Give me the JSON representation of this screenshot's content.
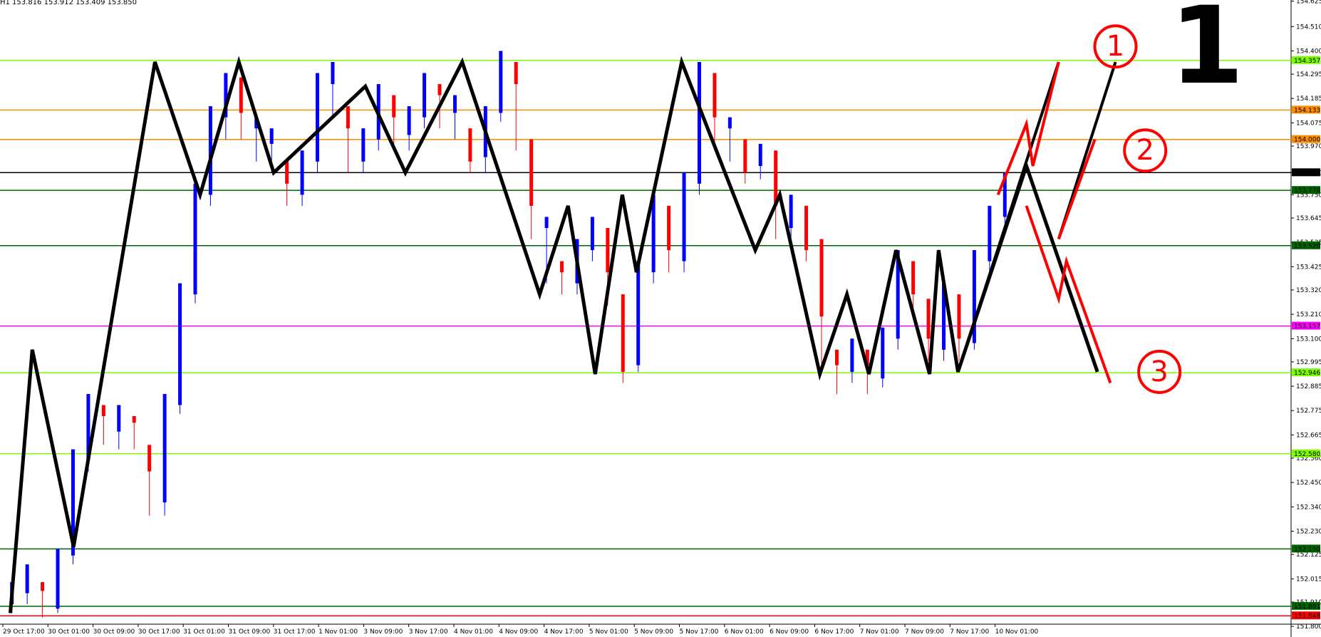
{
  "header": {
    "ohlc_text": "H1  153.816 153.912 153.409 153.850",
    "big_label": "1"
  },
  "chart_data": {
    "type": "candlestick",
    "price_axis": {
      "min": 151.81,
      "max": 154.63,
      "ticks": [
        "154.625",
        "154.510",
        "154.400",
        "154.295",
        "154.185",
        "154.075",
        "153.970",
        "153.850",
        "153.750",
        "153.645",
        "153.535",
        "153.425",
        "153.320",
        "153.210",
        "153.100",
        "152.995",
        "152.885",
        "152.775",
        "152.665",
        "152.560",
        "152.450",
        "152.340",
        "152.230",
        "152.125",
        "152.015",
        "151.910",
        "151.800"
      ]
    },
    "time_axis": {
      "labels": [
        "29 Oct 17:00",
        "30 Oct 01:00",
        "30 Oct 09:00",
        "30 Oct 17:00",
        "31 Oct 01:00",
        "31 Oct 09:00",
        "31 Oct 17:00",
        "1 Nov 01:00",
        "3 Nov 09:00",
        "3 Nov 17:00",
        "4 Nov 01:00",
        "4 Nov 09:00",
        "4 Nov 17:00",
        "5 Nov 01:00",
        "5 Nov 09:00",
        "5 Nov 17:00",
        "6 Nov 01:00",
        "6 Nov 09:00",
        "6 Nov 17:00",
        "7 Nov 01:00",
        "7 Nov 09:00",
        "7 Nov 17:00",
        "10 Nov 01:00"
      ]
    },
    "levels": [
      {
        "price": 154.357,
        "label": "154.357",
        "color": "#7cfc00"
      },
      {
        "price": 154.133,
        "label": "154.133",
        "color": "#ff8c00"
      },
      {
        "price": 154.0,
        "label": "154.000",
        "color": "#ff8c00"
      },
      {
        "price": 153.85,
        "label": "153.850",
        "color": "#000000"
      },
      {
        "price": 153.77,
        "label": "153.770",
        "color": "#006400"
      },
      {
        "price": 153.52,
        "label": "153.520",
        "color": "#006400"
      },
      {
        "price": 153.157,
        "label": "153.157",
        "color": "#ff00ff"
      },
      {
        "price": 152.946,
        "label": "152.946",
        "color": "#7cfc00"
      },
      {
        "price": 152.58,
        "label": "152.580",
        "color": "#7cfc00"
      },
      {
        "price": 152.15,
        "label": "152.150",
        "color": "#006400"
      },
      {
        "price": 151.891,
        "label": "151.891",
        "color": "#006400"
      },
      {
        "price": 151.848,
        "label": "151.848",
        "color": "#ff0000"
      }
    ],
    "candles": [
      [
        151.9,
        152.0,
        151.86,
        151.95
      ],
      [
        151.95,
        152.08,
        151.9,
        152.0
      ],
      [
        152.0,
        151.96,
        151.84,
        151.88
      ],
      [
        151.88,
        152.15,
        151.86,
        152.12
      ],
      [
        152.12,
        152.6,
        152.08,
        152.55
      ],
      [
        152.55,
        152.85,
        152.5,
        152.8
      ],
      [
        152.8,
        152.75,
        152.62,
        152.68
      ],
      [
        152.68,
        152.8,
        152.6,
        152.75
      ],
      [
        152.75,
        152.72,
        152.6,
        152.62
      ],
      [
        152.62,
        152.5,
        152.3,
        152.36
      ],
      [
        152.36,
        152.85,
        152.3,
        152.8
      ],
      [
        152.8,
        153.35,
        152.76,
        153.3
      ],
      [
        153.3,
        153.8,
        153.26,
        153.75
      ],
      [
        153.75,
        154.15,
        153.7,
        154.1
      ],
      [
        154.1,
        154.3,
        154.0,
        154.28
      ],
      [
        154.28,
        154.12,
        154.0,
        154.05
      ],
      [
        154.05,
        154.1,
        153.9,
        153.98
      ],
      [
        153.98,
        154.05,
        153.85,
        153.9
      ],
      [
        153.9,
        153.8,
        153.7,
        153.75
      ],
      [
        153.75,
        153.95,
        153.7,
        153.9
      ],
      [
        153.9,
        154.3,
        153.85,
        154.25
      ],
      [
        154.25,
        154.35,
        154.1,
        154.15
      ],
      [
        154.15,
        154.05,
        153.85,
        153.9
      ],
      [
        153.9,
        154.05,
        153.85,
        154.0
      ],
      [
        154.0,
        154.25,
        153.95,
        154.2
      ],
      [
        154.2,
        154.1,
        153.98,
        154.02
      ],
      [
        154.02,
        154.15,
        153.95,
        154.1
      ],
      [
        154.1,
        154.3,
        154.05,
        154.25
      ],
      [
        154.25,
        154.2,
        154.05,
        154.12
      ],
      [
        154.12,
        154.2,
        154.0,
        154.05
      ],
      [
        154.05,
        153.9,
        153.85,
        153.92
      ],
      [
        153.92,
        154.15,
        153.85,
        154.12
      ],
      [
        154.12,
        154.4,
        154.08,
        154.35
      ],
      [
        154.35,
        154.25,
        153.95,
        154.0
      ],
      [
        154.0,
        153.7,
        153.55,
        153.6
      ],
      [
        153.6,
        153.65,
        153.35,
        153.45
      ],
      [
        153.45,
        153.4,
        153.3,
        153.35
      ],
      [
        153.35,
        153.55,
        153.3,
        153.5
      ],
      [
        153.5,
        153.65,
        153.45,
        153.6
      ],
      [
        153.6,
        153.4,
        153.25,
        153.3
      ],
      [
        153.3,
        152.95,
        152.9,
        152.98
      ],
      [
        152.98,
        153.45,
        152.95,
        153.4
      ],
      [
        153.4,
        153.75,
        153.35,
        153.7
      ],
      [
        153.7,
        153.5,
        153.4,
        153.45
      ],
      [
        153.45,
        153.85,
        153.4,
        153.8
      ],
      [
        153.8,
        154.35,
        153.75,
        154.3
      ],
      [
        154.3,
        154.1,
        153.95,
        154.05
      ],
      [
        154.05,
        154.1,
        153.9,
        154.0
      ],
      [
        154.0,
        153.85,
        153.8,
        153.88
      ],
      [
        153.88,
        153.98,
        153.82,
        153.95
      ],
      [
        153.95,
        153.7,
        153.55,
        153.6
      ],
      [
        153.6,
        153.75,
        153.55,
        153.7
      ],
      [
        153.7,
        153.5,
        153.45,
        153.55
      ],
      [
        153.55,
        153.2,
        152.98,
        153.05
      ],
      [
        153.05,
        152.98,
        152.85,
        152.95
      ],
      [
        152.95,
        153.1,
        152.9,
        153.05
      ],
      [
        153.05,
        152.98,
        152.85,
        152.92
      ],
      [
        152.92,
        153.15,
        152.88,
        153.1
      ],
      [
        153.1,
        153.5,
        153.05,
        153.45
      ],
      [
        153.45,
        153.3,
        153.2,
        153.28
      ],
      [
        153.28,
        153.1,
        153.0,
        153.05
      ],
      [
        153.05,
        153.35,
        153.0,
        153.3
      ],
      [
        153.3,
        153.1,
        153.0,
        153.08
      ],
      [
        153.08,
        153.5,
        153.05,
        153.45
      ],
      [
        153.45,
        153.7,
        153.4,
        153.65
      ],
      [
        153.65,
        153.85,
        153.6,
        153.82
      ]
    ],
    "zigzag_black": [
      [
        0.008,
        151.86
      ],
      [
        0.025,
        153.05
      ],
      [
        0.057,
        152.16
      ],
      [
        0.12,
        154.35
      ],
      [
        0.155,
        153.75
      ],
      [
        0.185,
        154.35
      ],
      [
        0.212,
        153.85
      ],
      [
        0.283,
        154.24
      ],
      [
        0.314,
        153.85
      ],
      [
        0.358,
        154.35
      ],
      [
        0.418,
        153.3
      ],
      [
        0.44,
        153.7
      ],
      [
        0.461,
        152.94
      ],
      [
        0.482,
        153.75
      ],
      [
        0.493,
        153.4
      ],
      [
        0.528,
        154.35
      ],
      [
        0.585,
        153.5
      ],
      [
        0.604,
        153.75
      ],
      [
        0.635,
        152.94
      ],
      [
        0.656,
        153.3
      ],
      [
        0.673,
        152.94
      ],
      [
        0.694,
        153.5
      ],
      [
        0.72,
        152.94
      ],
      [
        0.727,
        153.5
      ],
      [
        0.742,
        152.95
      ],
      [
        0.795,
        153.88
      ],
      [
        0.85,
        152.95
      ]
    ],
    "channel_black": [
      [
        [
          0.742,
          152.95
        ],
        [
          0.82,
          154.35
        ]
      ],
      [
        [
          0.82,
          153.55
        ],
        [
          0.864,
          154.35
        ]
      ]
    ],
    "channel_red": [
      [
        [
          0.773,
          153.75
        ],
        [
          0.795,
          154.07
        ],
        [
          0.8,
          153.88
        ],
        [
          0.82,
          154.35
        ]
      ],
      [
        [
          0.82,
          153.55
        ],
        [
          0.848,
          154.0
        ]
      ],
      [
        [
          0.795,
          153.7
        ],
        [
          0.82,
          153.28
        ],
        [
          0.826,
          153.45
        ],
        [
          0.86,
          152.9
        ]
      ]
    ],
    "annotations": [
      {
        "text": "①",
        "x": 0.843,
        "price": 154.42
      },
      {
        "text": "②",
        "x": 0.866,
        "price": 153.95
      },
      {
        "text": "③",
        "x": 0.877,
        "price": 152.95
      }
    ],
    "colors": {
      "bull": "#0000ff",
      "bear": "#ff0000",
      "zigzag": "#000000",
      "channel_red": "#ff0000",
      "grid_text": "#000000"
    },
    "grid": false
  }
}
